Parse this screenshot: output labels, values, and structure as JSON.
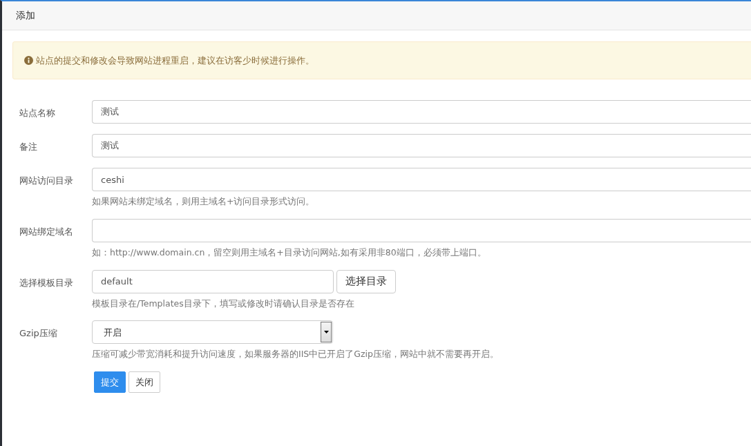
{
  "title": "添加",
  "notice": "站点的提交和修改会导致网站进程重启，建议在访客少时候进行操作。",
  "fields": [
    {
      "kind": "text",
      "label": "站点名称",
      "value": "测试"
    },
    {
      "kind": "text",
      "label": "备注",
      "value": "测试"
    },
    {
      "kind": "text",
      "label": "网站访问目录",
      "value": "ceshi",
      "help": "如果网站未绑定域名，则用主域名+访问目录形式访问。"
    },
    {
      "kind": "text",
      "label": "网站绑定域名",
      "help": "如：http://www.domain.cn，留空则用主域名+目录访问网站,如有采用非80端口，必须带上端口。"
    },
    {
      "kind": "browse",
      "label": "选择模板目录",
      "value": "default",
      "button": "选择目录",
      "help": "模板目录在/Templates目录下，填写或修改时请确认目录是否存在"
    },
    {
      "kind": "select",
      "label": "Gzip压缩",
      "value": "开启",
      "help": "压缩可减少带宽消耗和提升访问速度，如果服务器的IIS中已开启了Gzip压缩，网站中就不需要再开启。"
    }
  ],
  "buttons": [
    {
      "kind": "primary",
      "label": "提交"
    },
    {
      "kind": "default",
      "label": "关闭"
    }
  ]
}
